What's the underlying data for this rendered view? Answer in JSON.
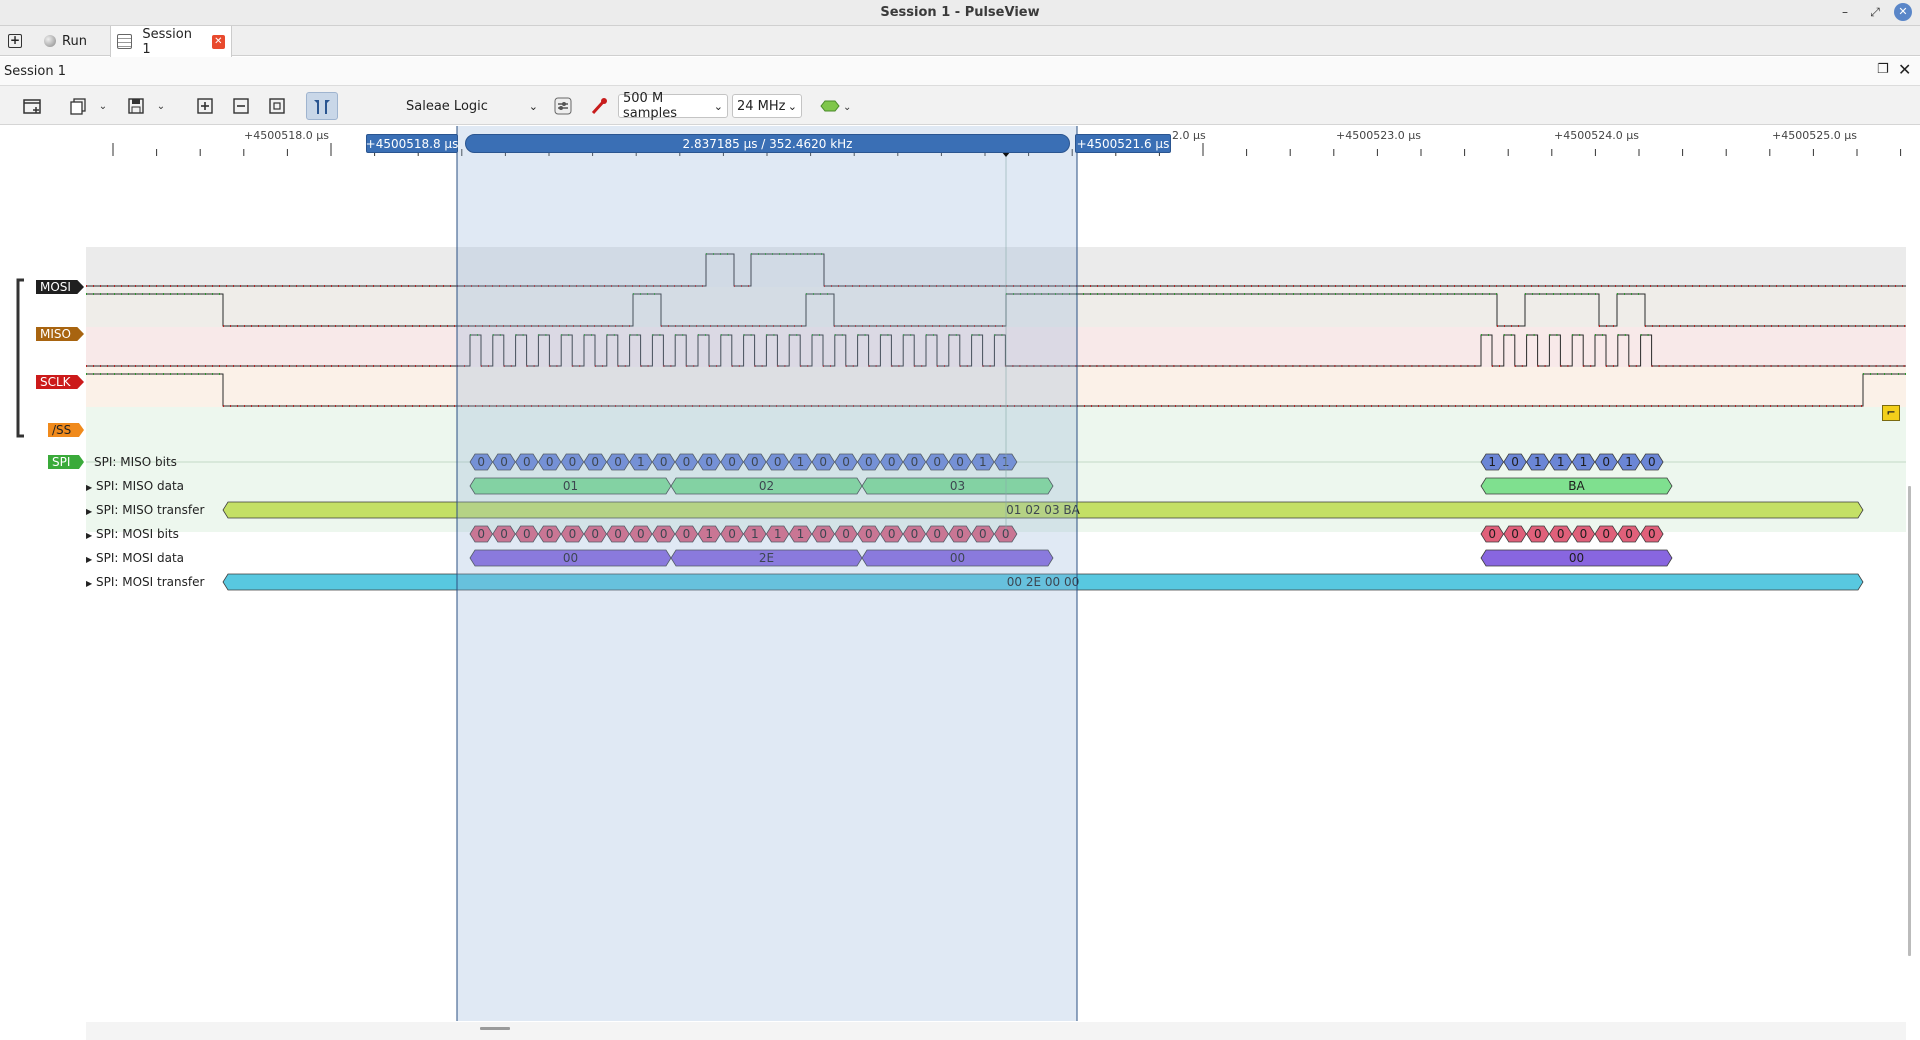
{
  "window": {
    "title": "Session 1 - PulseView"
  },
  "tabs": [
    {
      "label": "Run"
    },
    {
      "label": "Session 1"
    }
  ],
  "session": {
    "label": "Session 1"
  },
  "toolbar": {
    "device": "Saleae Logic",
    "samples": "500 M samples",
    "samplerate": "24 MHz"
  },
  "ruler": {
    "ticks": [
      "+4500518.0 µs",
      "2.0 µs",
      "+4500523.0 µs",
      "+4500524.0 µs",
      "+4500525.0 µs"
    ],
    "cursor_left": "+4500518.8 µs",
    "cursor_right": "+4500521.6 µs",
    "cursor_span": "2.837185 µs / 352.4620 kHz"
  },
  "channels": [
    {
      "name": "MOSI",
      "color": "#1f1f1f"
    },
    {
      "name": "MISO",
      "color": "#a86410"
    },
    {
      "name": "SCLK",
      "color": "#cc1a1a"
    },
    {
      "name": "/SS",
      "color": "#f08a1c"
    }
  ],
  "decoder": {
    "name": "SPI",
    "color": "#3aaa3a",
    "rows": [
      {
        "label": "SPI: MISO bits"
      },
      {
        "label": "SPI: MISO data"
      },
      {
        "label": "SPI: MISO transfer"
      },
      {
        "label": "SPI: MOSI bits"
      },
      {
        "label": "SPI: MOSI data"
      },
      {
        "label": "SPI: MOSI transfer"
      }
    ],
    "miso_bits_1": [
      "0",
      "0",
      "0",
      "0",
      "0",
      "0",
      "0",
      "1",
      "0",
      "0",
      "0",
      "0",
      "0",
      "0",
      "1",
      "0",
      "0",
      "0",
      "0",
      "0",
      "0",
      "0",
      "1",
      "1"
    ],
    "miso_bits_2": [
      "1",
      "0",
      "1",
      "1",
      "1",
      "0",
      "1",
      "0"
    ],
    "mosi_bits_1": [
      "0",
      "0",
      "0",
      "0",
      "0",
      "0",
      "0",
      "0",
      "0",
      "0",
      "1",
      "0",
      "1",
      "1",
      "1",
      "0",
      "0",
      "0",
      "0",
      "0",
      "0",
      "0",
      "0",
      "0"
    ],
    "mosi_bits_2": [
      "0",
      "0",
      "0",
      "0",
      "0",
      "0",
      "0",
      "0"
    ],
    "miso_data": [
      "01",
      "02",
      "03",
      "BA"
    ],
    "mosi_data": [
      "00",
      "2E",
      "00",
      "00"
    ],
    "miso_transfer": "01 02 03 BA",
    "mosi_transfer": "00 2E 00 00",
    "colors": {
      "miso_bits": "#6b86d6",
      "miso_data": "#7fe08f",
      "miso_transfer": "#c4e066",
      "mosi_bits": "#e0607a",
      "mosi_data": "#8866e0",
      "mosi_transfer": "#58c8e0"
    }
  }
}
